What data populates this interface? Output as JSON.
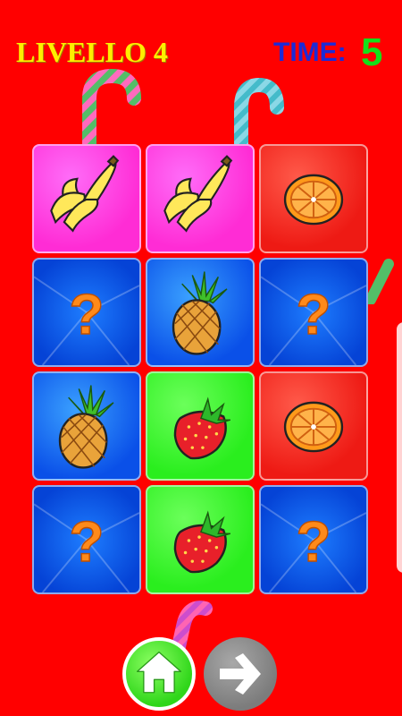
{
  "header": {
    "level_text": "LIVELLO 4",
    "time_label": "TIME:",
    "time_value": "5"
  },
  "board": {
    "columns": 3,
    "rows": 4,
    "cards": [
      {
        "state": "revealed",
        "fruit": "banana",
        "color": "#ff33dd"
      },
      {
        "state": "revealed",
        "fruit": "banana",
        "color": "#ff33dd"
      },
      {
        "state": "revealed",
        "fruit": "orange",
        "color": "#ff2a20"
      },
      {
        "state": "hidden",
        "symbol": "?",
        "color": "#0a55ee"
      },
      {
        "state": "revealed",
        "fruit": "pineapple",
        "color": "#1e84ff"
      },
      {
        "state": "hidden",
        "symbol": "?",
        "color": "#0a55ee"
      },
      {
        "state": "revealed",
        "fruit": "pineapple",
        "color": "#1e84ff"
      },
      {
        "state": "revealed",
        "fruit": "strawberry",
        "color": "#3cf02e"
      },
      {
        "state": "revealed",
        "fruit": "orange",
        "color": "#ff2a20"
      },
      {
        "state": "hidden",
        "symbol": "?",
        "color": "#0a55ee"
      },
      {
        "state": "revealed",
        "fruit": "strawberry",
        "color": "#3cf02e"
      },
      {
        "state": "hidden",
        "symbol": "?",
        "color": "#0a55ee"
      }
    ]
  },
  "buttons": {
    "home_icon": "home-icon",
    "next_icon": "arrow-right-icon"
  },
  "colors": {
    "background": "#ff0000",
    "level_text": "#ffee00",
    "time_label": "#1b2bd8",
    "time_value": "#14e01a"
  }
}
